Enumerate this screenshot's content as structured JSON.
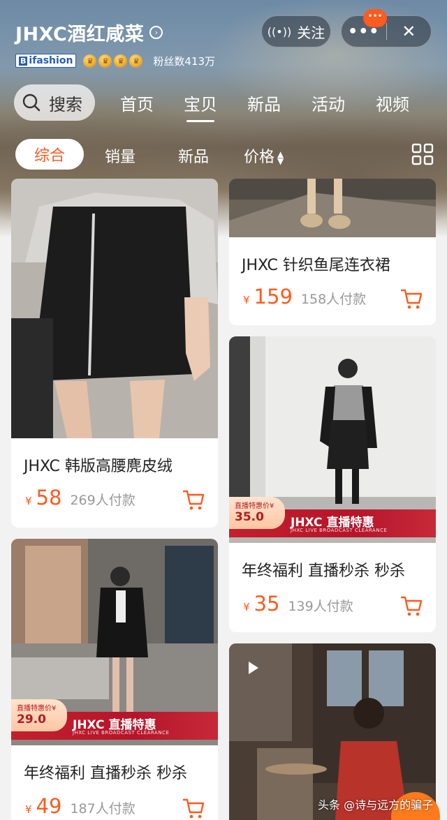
{
  "header": {
    "store_name": "JHXC酒红咸菜",
    "follow_label": "关注",
    "more_label": "•••",
    "close_label": "✕",
    "notification_badge": "•••",
    "brand_badge": "ifashion",
    "brand_badge_mark": "B",
    "crown_count": 4,
    "fans_text": "粉丝数413万"
  },
  "nav": {
    "search_label": "搜索",
    "tabs": [
      "首页",
      "宝贝",
      "新品",
      "活动",
      "视频"
    ],
    "active_tab": "宝贝"
  },
  "sort": {
    "items": [
      "综合",
      "销量",
      "新品",
      "价格"
    ],
    "active": "综合"
  },
  "products": [
    {
      "title": "JHXC 韩版高腰麂皮绒",
      "currency": "¥",
      "price": "58",
      "paid": "269人付款"
    },
    {
      "title": "JHXC 针织鱼尾连衣裙",
      "currency": "¥",
      "price": "159",
      "paid": "158人付款"
    },
    {
      "title": "年终福利 直播秒杀 秒杀",
      "currency": "¥",
      "price": "35",
      "paid": "139人付款",
      "live": {
        "badge_small": "直播特惠价¥",
        "badge_price": "35.0",
        "text": "JHXC 直播特惠",
        "sub": "JHXC LIVE BROADCAST CLEARANCE"
      }
    },
    {
      "title": "年终福利 直播秒杀 秒杀",
      "currency": "¥",
      "price": "49",
      "paid": "187人付款",
      "live": {
        "badge_small": "直播特惠价¥",
        "badge_price": "29.0",
        "text": "JHXC 直播特惠",
        "sub": "JHXC LIVE BROADCAST CLEARANCE"
      }
    }
  ],
  "watermark": "头条 @诗与远方的骗子",
  "colors": {
    "accent": "#ff5a1f",
    "live_red": "#c41f2d"
  }
}
